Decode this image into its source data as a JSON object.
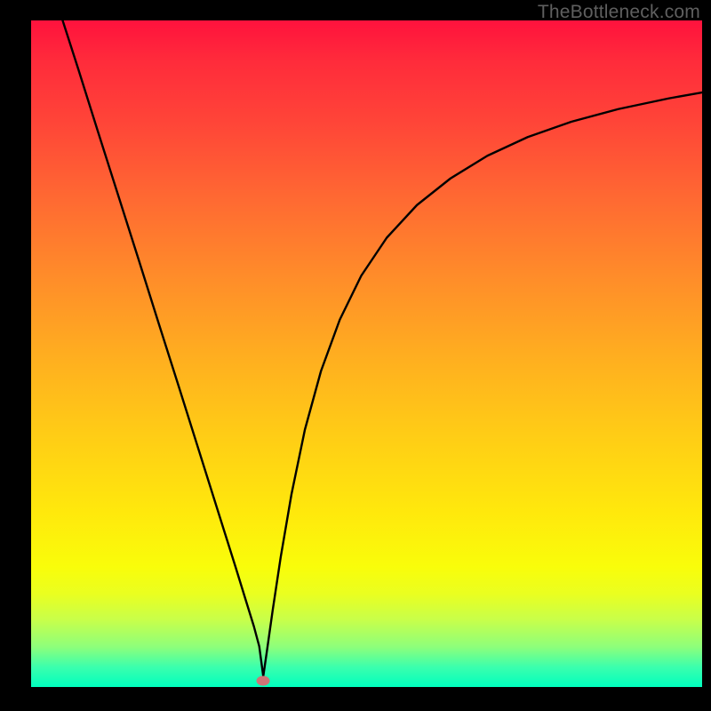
{
  "watermark": "TheBottleneck.com",
  "marker": {
    "x_frac": 0.346,
    "y_frac": 0.991,
    "color": "#cf7477"
  },
  "chart_data": {
    "type": "line",
    "title": "",
    "xlabel": "",
    "ylabel": "",
    "xlim": [
      0,
      1
    ],
    "ylim": [
      0,
      1
    ],
    "gradient_stops": [
      {
        "pos": 0.0,
        "color": "#ff123d"
      },
      {
        "pos": 0.06,
        "color": "#ff2b3b"
      },
      {
        "pos": 0.15,
        "color": "#ff4438"
      },
      {
        "pos": 0.27,
        "color": "#ff6a32"
      },
      {
        "pos": 0.38,
        "color": "#ff8b2a"
      },
      {
        "pos": 0.5,
        "color": "#ffad20"
      },
      {
        "pos": 0.62,
        "color": "#ffcc16"
      },
      {
        "pos": 0.74,
        "color": "#ffe90c"
      },
      {
        "pos": 0.82,
        "color": "#f9fd0a"
      },
      {
        "pos": 0.86,
        "color": "#eaff20"
      },
      {
        "pos": 0.9,
        "color": "#c7ff4b"
      },
      {
        "pos": 0.94,
        "color": "#8dff7b"
      },
      {
        "pos": 0.97,
        "color": "#3bffad"
      },
      {
        "pos": 1.0,
        "color": "#00ffbe"
      }
    ],
    "series": [
      {
        "name": "bottleneck-curve",
        "x": [
          0.047,
          0.07,
          0.1,
          0.13,
          0.16,
          0.19,
          0.22,
          0.25,
          0.28,
          0.305,
          0.32,
          0.332,
          0.34,
          0.346,
          0.352,
          0.36,
          0.372,
          0.388,
          0.408,
          0.432,
          0.46,
          0.492,
          0.53,
          0.575,
          0.625,
          0.68,
          0.74,
          0.805,
          0.875,
          0.95,
          1.0
        ],
        "y": [
          1.0,
          0.928,
          0.832,
          0.737,
          0.642,
          0.546,
          0.451,
          0.355,
          0.259,
          0.179,
          0.13,
          0.091,
          0.061,
          0.016,
          0.058,
          0.115,
          0.195,
          0.289,
          0.386,
          0.474,
          0.551,
          0.617,
          0.674,
          0.723,
          0.763,
          0.797,
          0.825,
          0.848,
          0.867,
          0.883,
          0.892
        ]
      }
    ],
    "marker_point": {
      "x": 0.346,
      "y": 0.009
    }
  }
}
